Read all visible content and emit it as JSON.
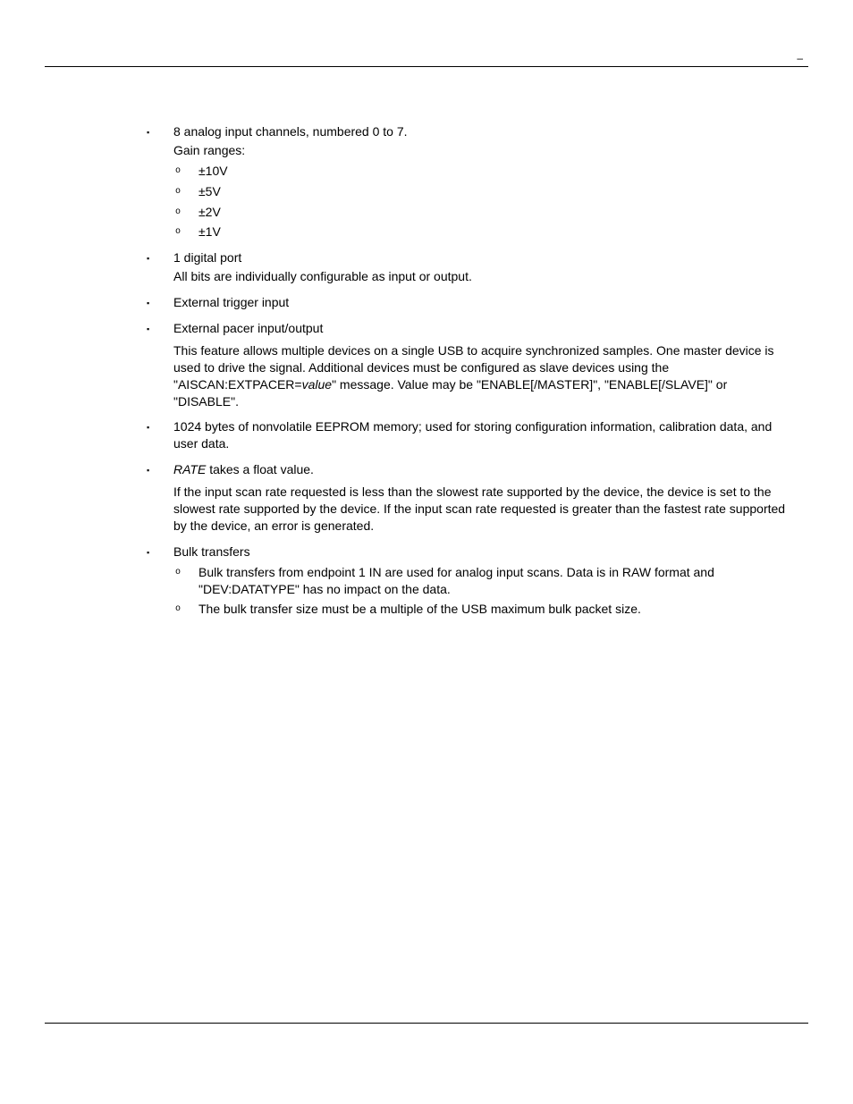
{
  "header": {
    "dash": "–"
  },
  "items": [
    {
      "lead": "8 analog input channels, numbered 0 to 7.",
      "sub_lead": "Gain ranges:",
      "sub_items": [
        "±10V",
        "±5V",
        "±2V",
        "±1V"
      ]
    },
    {
      "lead": "1 digital port",
      "para1": "All bits are individually configurable as input or output."
    },
    {
      "lead": "External trigger input"
    },
    {
      "lead": "External pacer input/output",
      "para1_a": "This feature allows multiple devices on a single USB to acquire synchronized samples. One master device is used to drive the signal. Additional devices must be configured as slave devices using the \"AISCAN:EXTPACER=",
      "para1_em": "value",
      "para1_b": "\" message. Value may be \"ENABLE[/MASTER]\", \"ENABLE[/SLAVE]\" or \"DISABLE\"."
    },
    {
      "lead": "1024 bytes of nonvolatile EEPROM memory; used for storing configuration information, calibration data, and user data."
    },
    {
      "lead_em": "RATE",
      "lead_tail": " takes a float value.",
      "para1": "If the input scan rate requested is less than the slowest rate supported by the device, the device is set to the slowest rate supported by the device. If the input scan rate requested is greater than the fastest rate supported by the device, an error is generated."
    },
    {
      "lead": "Bulk transfers",
      "sub_items": [
        "Bulk transfers from endpoint 1 IN are used for analog input scans. Data is in RAW format and \"DEV:DATATYPE\" has no impact on the data.",
        "The bulk transfer size must be a multiple of the USB maximum bulk packet size."
      ]
    }
  ]
}
